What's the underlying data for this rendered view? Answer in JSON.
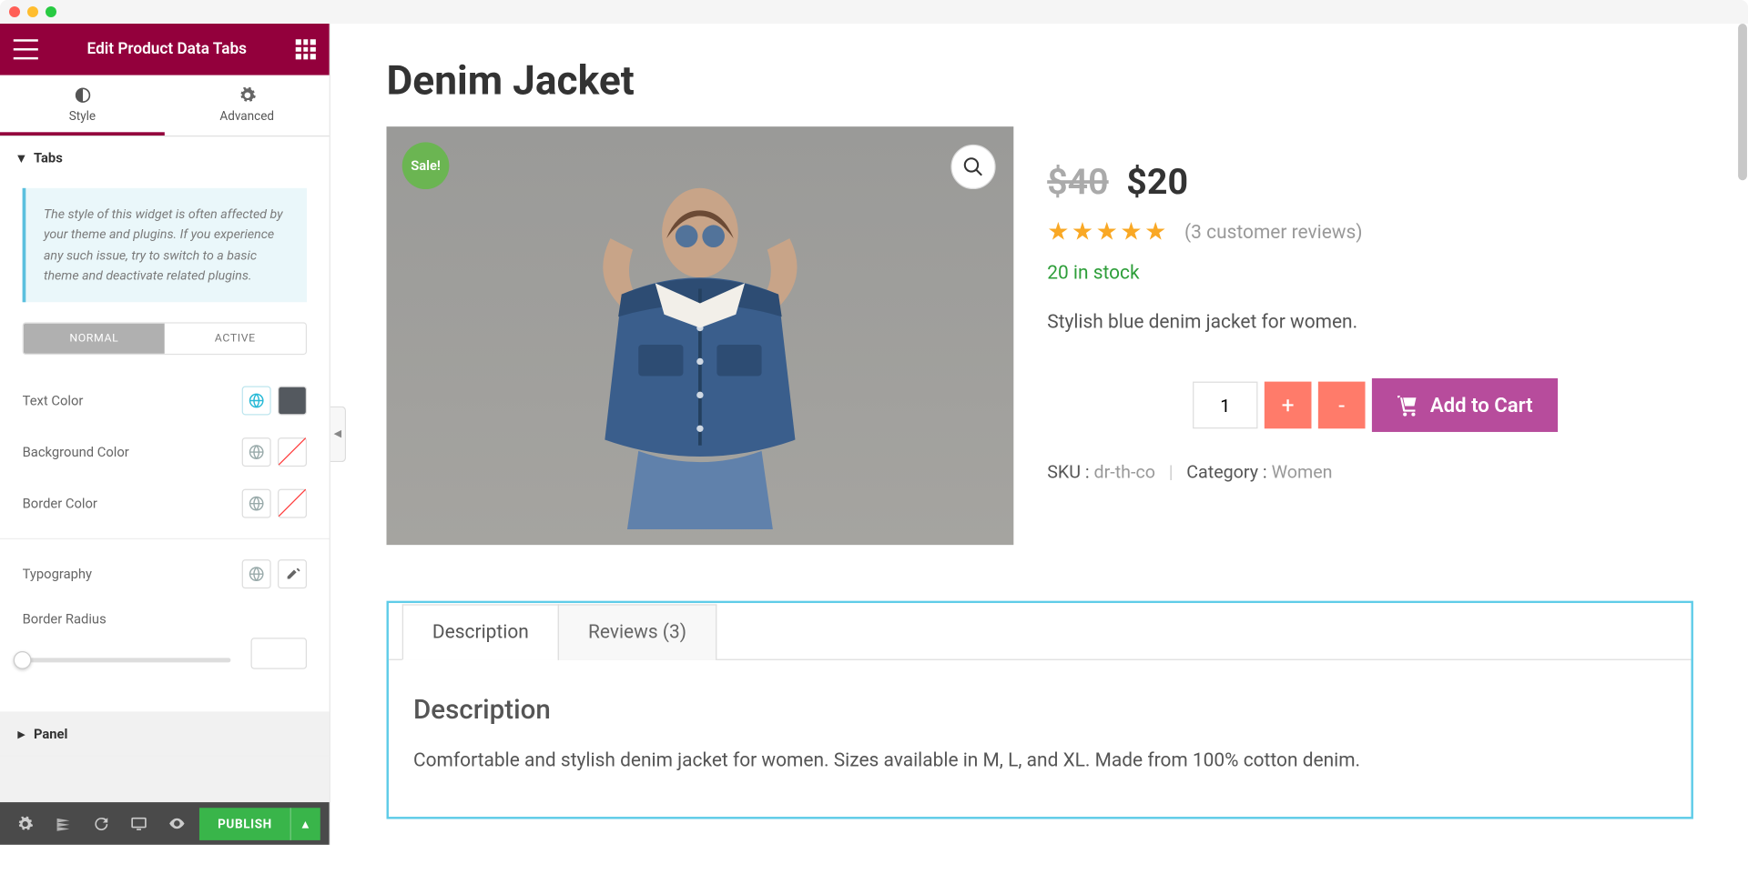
{
  "header": {
    "title": "Edit Product Data Tabs"
  },
  "editorTabs": {
    "style": "Style",
    "advanced": "Advanced"
  },
  "sections": {
    "tabs": {
      "title": "Tabs",
      "info": "The style of this widget is often affected by your theme and plugins. If you experience any such issue, try to switch to a basic theme and deactivate related plugins.",
      "state_normal": "NORMAL",
      "state_active": "ACTIVE",
      "rows": {
        "text_color": "Text Color",
        "background_color": "Background Color",
        "border_color": "Border Color",
        "typography": "Typography",
        "border_radius": "Border Radius"
      }
    },
    "panel": {
      "title": "Panel"
    }
  },
  "footer": {
    "publish": "PUBLISH"
  },
  "product": {
    "title": "Denim Jacket",
    "sale_label": "Sale!",
    "price_old": "$40",
    "price_new": "$20",
    "reviews_text": "(3 customer reviews)",
    "stock": "20 in stock",
    "short_desc": "Stylish blue denim jacket for women.",
    "qty": "1",
    "btn_plus": "+",
    "btn_minus": "-",
    "add_to_cart": "Add to Cart",
    "sku_label": "SKU :",
    "sku": "dr-th-co",
    "category_label": "Category :",
    "category": "Women"
  },
  "dataTabs": {
    "tab1": "Description",
    "tab2": "Reviews (3)",
    "heading": "Description",
    "content": "Comfortable and stylish denim jacket for women. Sizes available in M, L, and XL. Made from 100% cotton denim."
  }
}
